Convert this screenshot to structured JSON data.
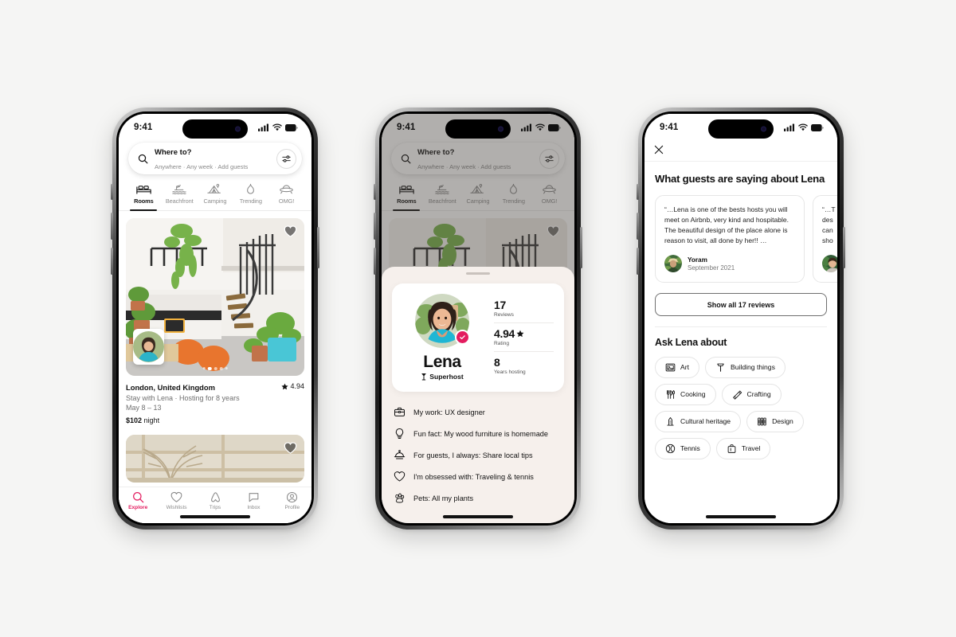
{
  "background_color": "#f5f5f4",
  "accent_color": "#e31c5f",
  "phones": {
    "explore": {
      "status_bar": {
        "time": "9:41",
        "cellular_icon": "signal-bars-icon",
        "wifi_icon": "wifi-icon",
        "battery_icon": "battery-icon"
      },
      "search": {
        "search_icon": "search-icon",
        "title": "Where to?",
        "subtitle": "Anywhere · Any week · Add guests",
        "filter_icon": "filter-sliders-icon"
      },
      "categories": [
        {
          "label": "Rooms",
          "icon": "bed-rooms-icon",
          "active": true
        },
        {
          "label": "Beachfront",
          "icon": "beachfront-icon",
          "active": false
        },
        {
          "label": "Camping",
          "icon": "camping-tent-icon",
          "active": false
        },
        {
          "label": "Trending",
          "icon": "flame-trending-icon",
          "active": false
        },
        {
          "label": "OMG!",
          "icon": "omg-ufo-icon",
          "active": false
        }
      ],
      "listing": {
        "heart_icon": "heart-icon",
        "host_avatar": "host-avatar-lena",
        "title": "London, United Kingdom",
        "rating": "4.94",
        "star_icon": "star-icon",
        "subtitle": "Stay with Lena · Hosting for 8 years",
        "dates": "May 8 – 13",
        "price": "$102",
        "price_unit": "night",
        "photo_dots": 5,
        "photo_active_dot": 2
      },
      "listing2": {
        "heart_icon": "heart-icon"
      },
      "tabbar": [
        {
          "label": "Explore",
          "icon": "search-icon",
          "active": true
        },
        {
          "label": "Wishlists",
          "icon": "heart-icon",
          "active": false
        },
        {
          "label": "Trips",
          "icon": "airbnb-belo-icon",
          "active": false
        },
        {
          "label": "Inbox",
          "icon": "chat-bubble-icon",
          "active": false
        },
        {
          "label": "Profile",
          "icon": "profile-avatar-icon",
          "active": false
        }
      ]
    },
    "profile_sheet": {
      "status_bar": {
        "time": "9:41"
      },
      "grabber": "sheet-grabber",
      "card": {
        "avatar": "lena-avatar",
        "verified_icon": "verified-check-icon",
        "name": "Lena",
        "superhost_icon": "superhost-badge-icon",
        "superhost_label": "Superhost",
        "stats": [
          {
            "value": "17",
            "label": "Reviews",
            "has_star": false
          },
          {
            "value": "4.94",
            "label": "Rating",
            "has_star": true
          },
          {
            "value": "8",
            "label": "Years hosting",
            "has_star": false
          }
        ]
      },
      "facts": [
        {
          "icon": "briefcase-icon",
          "text": "My work: UX designer"
        },
        {
          "icon": "lightbulb-icon",
          "text": "Fun fact: My wood furniture is homemade"
        },
        {
          "icon": "bell-service-icon",
          "text": "For guests, I always: Share local tips"
        },
        {
          "icon": "heart-icon",
          "text": "I'm obsessed with: Traveling & tennis"
        },
        {
          "icon": "paw-print-icon",
          "text": "Pets: All my plants"
        }
      ]
    },
    "reviews": {
      "status_bar": {
        "time": "9:41"
      },
      "close_icon": "close-x-icon",
      "title": "What guests are saying about Lena",
      "reviews": [
        {
          "text": "“…Lena is one of the bests hosts you will meet on Airbnb, very kind and hospitable. The beautiful design of the place alone is reason to visit, all done by her!! …",
          "author": "Yoram",
          "date": "September 2021",
          "avatar": "yoram-avatar"
        },
        {
          "text": "“…T des can sho",
          "author": "",
          "date": "",
          "avatar": "reviewer-avatar-2"
        }
      ],
      "show_all_label": "Show all 17 reviews",
      "ask_title": "Ask Lena about",
      "chips": [
        {
          "label": "Art",
          "icon": "art-frame-icon"
        },
        {
          "label": "Building things",
          "icon": "hammer-icon"
        },
        {
          "label": "Cooking",
          "icon": "cutlery-icon"
        },
        {
          "label": "Crafting",
          "icon": "crafting-icon"
        },
        {
          "label": "Cultural heritage",
          "icon": "monument-icon"
        },
        {
          "label": "Design",
          "icon": "design-books-icon"
        },
        {
          "label": "Tennis",
          "icon": "tennis-ball-icon"
        },
        {
          "label": "Travel",
          "icon": "suitcase-icon"
        }
      ]
    }
  }
}
